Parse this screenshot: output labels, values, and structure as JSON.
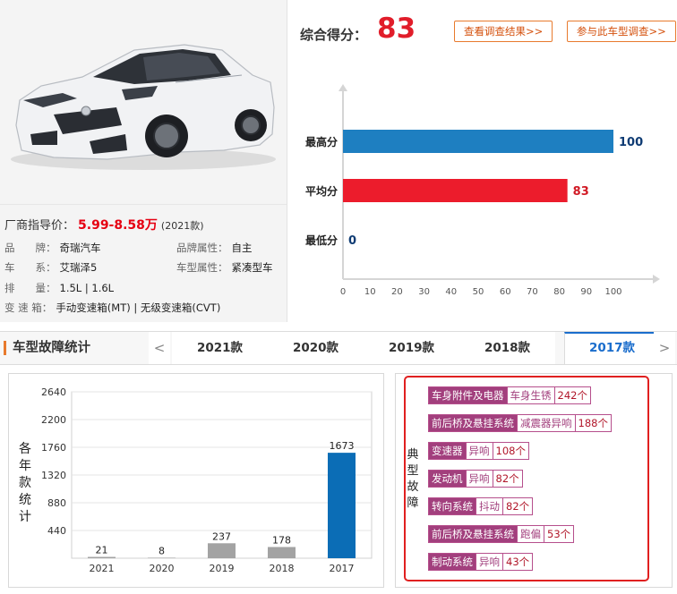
{
  "colors": {
    "accent_red": "#e11d2a",
    "accent_orange": "#e87a2d",
    "tab_active_blue": "#1a6dcc",
    "bar_max_blue": "#1e7fc1",
    "bar_avg_red": "#ec1c2c",
    "bar_gray": "#a3a3a3",
    "bar_highlight_blue": "#0b6db6",
    "fault_purple": "#a23f7d"
  },
  "car": {
    "image_icon": "sedan-car-photo",
    "price_label": "厂商指导价：",
    "price_value": "5.99-8.58万",
    "price_year": "(2021款)",
    "specs": [
      {
        "key": "品　　牌：",
        "value": "奇瑞汽车"
      },
      {
        "key": "品牌属性：",
        "value": "自主"
      },
      {
        "key": "车　　系：",
        "value": "艾瑞泽5"
      },
      {
        "key": "车型属性：",
        "value": "紧凑型车"
      },
      {
        "key": "排　　量：",
        "value": "1.5L | 1.6L"
      },
      {
        "key": "变 速 箱：",
        "value": "手动变速箱(MT) | 无级变速箱(CVT)"
      }
    ]
  },
  "score": {
    "label": "综合得分：",
    "value": "83",
    "buttons": [
      "查看调查结果>>",
      "参与此车型调查>>"
    ]
  },
  "tabs": {
    "title": "车型故障统计",
    "prev_arrow": "<",
    "next_arrow": ">",
    "items": [
      "2021款",
      "2020款",
      "2019款",
      "2018款",
      "2017款"
    ],
    "active_index": 4
  },
  "faults": {
    "vertical_label": "典型故障",
    "items": [
      {
        "category": "车身附件及电器",
        "symptom": "车身生锈",
        "count": "242个"
      },
      {
        "category": "前后桥及悬挂系统",
        "symptom": "减震器异响",
        "count": "188个"
      },
      {
        "category": "变速器",
        "symptom": "异响",
        "count": "108个"
      },
      {
        "category": "发动机",
        "symptom": "异响",
        "count": "82个"
      },
      {
        "category": "转向系统",
        "symptom": "抖动",
        "count": "82个"
      },
      {
        "category": "前后桥及悬挂系统",
        "symptom": "跑偏",
        "count": "53个"
      },
      {
        "category": "制动系统",
        "symptom": "异响",
        "count": "43个"
      }
    ]
  },
  "chart_data": [
    {
      "type": "bar",
      "orientation": "horizontal",
      "categories": [
        "最高分",
        "平均分",
        "最低分"
      ],
      "values": [
        100,
        83,
        0
      ],
      "xlim": [
        0,
        100
      ],
      "xticks": [
        0,
        10,
        20,
        30,
        40,
        50,
        60,
        70,
        80,
        90,
        100
      ],
      "bar_colors": [
        "#1e7fc1",
        "#ec1c2c",
        "#1e7fc1"
      ],
      "label_colors": [
        "#0e3b73",
        "#d11a25",
        "#0e3b73"
      ],
      "grid": false
    },
    {
      "type": "bar",
      "orientation": "vertical",
      "categories": [
        "2021",
        "2020",
        "2019",
        "2018",
        "2017"
      ],
      "values": [
        21,
        8,
        237,
        178,
        1673
      ],
      "ylabel": "各年款统计",
      "ylim": [
        0,
        2640
      ],
      "yticks": [
        440,
        880,
        1320,
        1760,
        2200,
        2640
      ],
      "bar_colors": [
        "#a3a3a3",
        "#a3a3a3",
        "#a3a3a3",
        "#a3a3a3",
        "#0b6db6"
      ],
      "grid": true
    }
  ]
}
